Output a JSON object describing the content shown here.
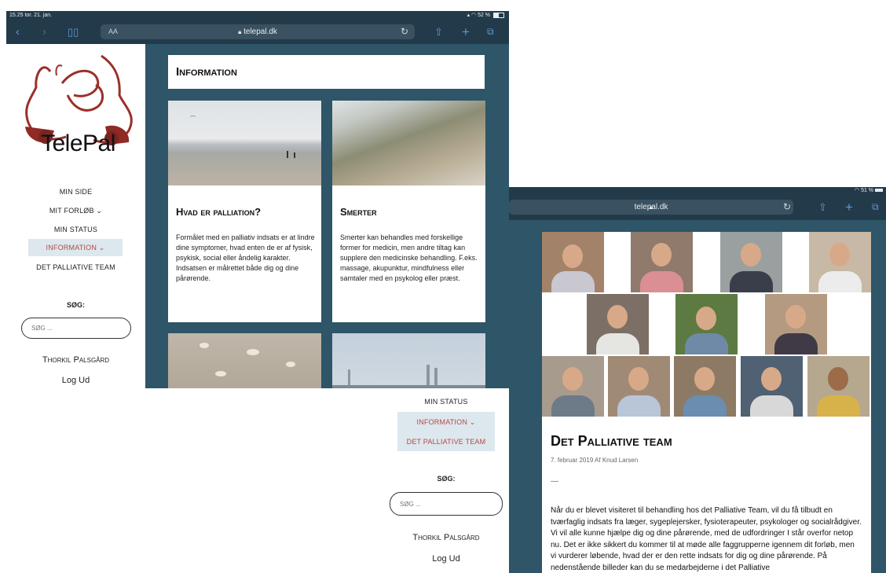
{
  "s1": {
    "status_left": "15.25  tor. 21. jan.",
    "status_right": "52 %",
    "text_size": "AA",
    "url": "telepal.dk",
    "logo": "TelePal",
    "nav": [
      "MIN SIDE",
      "MIT FORLØB ⌄",
      "MIN STATUS",
      "INFORMATION ⌄",
      "DET PALLIATIVE TEAM"
    ],
    "search_label": "SØG:",
    "search_placeholder": "SØG ...",
    "user": "Thorkil Palsgård",
    "logout": "Log Ud",
    "heading": "Information",
    "cards": [
      {
        "title": "Hvad er palliation?",
        "text": "Formålet med en palliativ indsats er at lindre dine symptomer, hvad enten de er af fysisk, psykisk, social eller åndelig karakter. Indsatsen er målrettet både dig og dine pårørende."
      },
      {
        "title": "Smerter",
        "text": "Smerter kan behandles med forskellige former for medicin, men andre tiltag kan supplere den medicinske behandling. F.eks. massage, akupunktur, mindfulness eller samtaler med en psykolog eller præst."
      }
    ]
  },
  "s2": {
    "nav": [
      "MIN STATUS",
      "INFORMATION ⌄",
      "DET PALLIATIVE TEAM"
    ],
    "search_label": "SØG:",
    "search_placeholder": "SØG ...",
    "user": "Thorkil Palsgård",
    "logout": "Log Ud"
  },
  "s3": {
    "status_right": "51 %",
    "url": "telepal.dk",
    "title": "Det Palliative team",
    "meta": "7. februar 2019 Af Knud Larsen",
    "dash": "—",
    "body": "Når du er blevet visiteret til behandling hos det Palliative Team, vil du få tilbudt en tværfaglig indsats fra læger, sygeplejersker, fysioterapeuter, psykologer og socialrådgiver. Vi vil alle kunne hjælpe dig og dine pårørende, med de udfordringer I står overfor netop nu. Det er ikke sikkert du kommer til at møde alle faggrupperne igennem dit forløb, men vi vurderer løbende, hvad der er den rette indsats for dig og dine pårørende. På nedenstående billeder kan du se medarbejderne i det Palliative"
  },
  "colors": {
    "teal": "#2e5568",
    "toolbar": "#233a4a",
    "active_text": "#b04a45",
    "active_bg": "#dde7ee",
    "logo_red": "#9b2f2a"
  },
  "icons": [
    "back-chevron-icon",
    "forward-chevron-icon",
    "bookmarks-icon",
    "lock-icon",
    "reload-icon",
    "share-icon",
    "plus-icon",
    "tabs-icon",
    "wifi-icon",
    "battery-icon",
    "dropdown-chevron-icon"
  ]
}
